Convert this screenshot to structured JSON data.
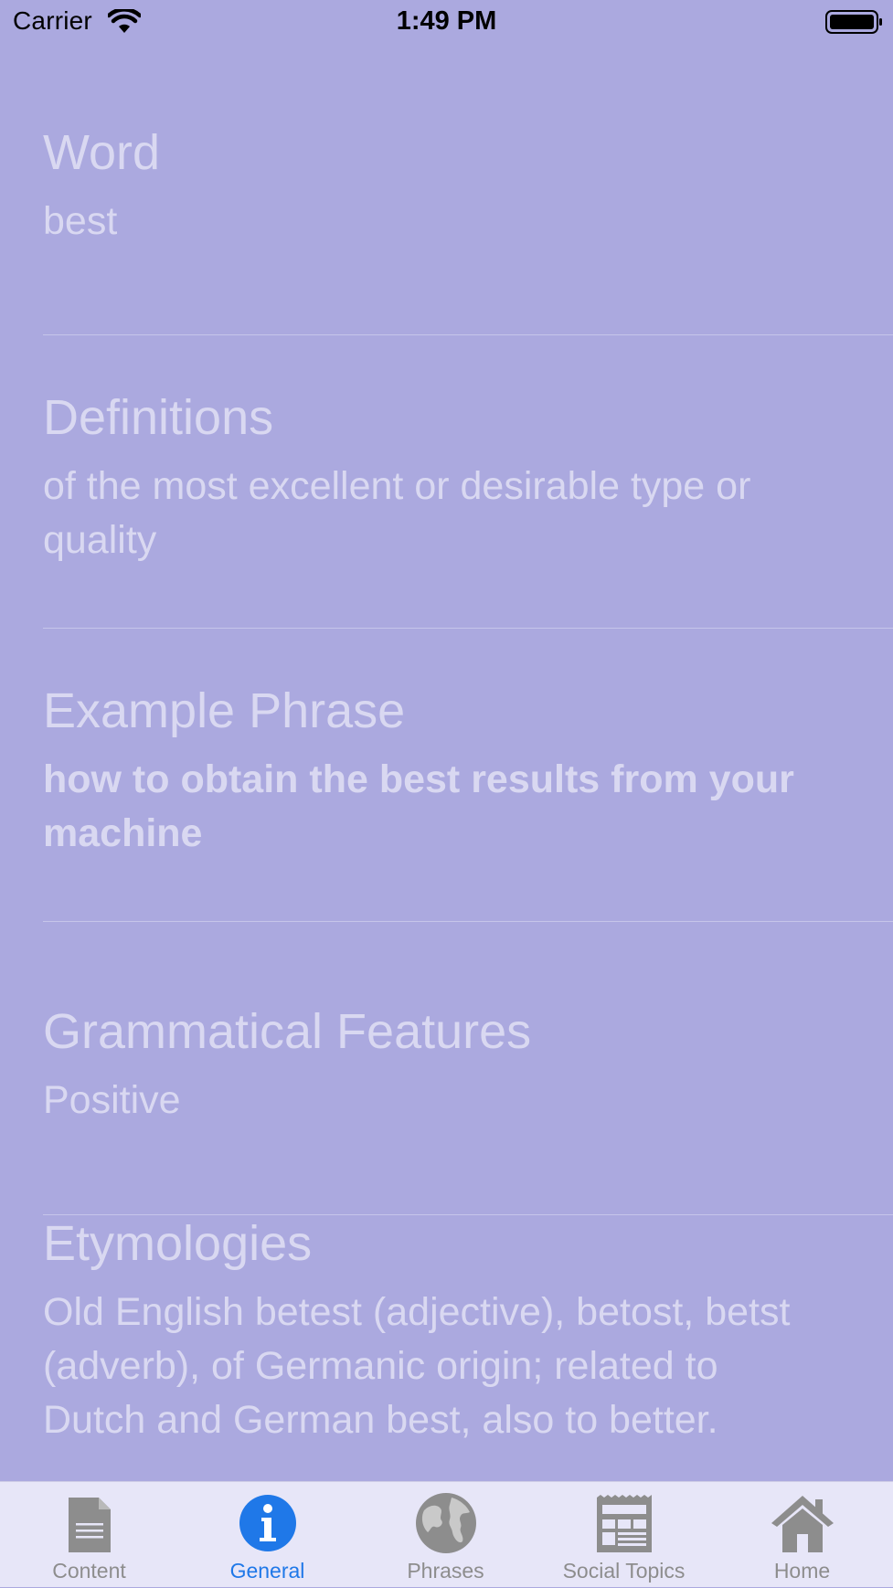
{
  "status_bar": {
    "carrier": "Carrier",
    "time": "1:49 PM"
  },
  "sections": [
    {
      "title": "Word",
      "body": "best"
    },
    {
      "title": "Definitions",
      "body": "of the most excellent or desirable type or quality"
    },
    {
      "title": "Example Phrase",
      "body": "how to obtain the best results from your machine"
    },
    {
      "title": "Grammatical Features",
      "body": "Positive"
    },
    {
      "title": "Etymologies",
      "body": "Old English betest (adjective), betost, betst (adverb), of Germanic origin; related to Dutch and German best, also to better."
    }
  ],
  "tab_bar": {
    "tabs": [
      {
        "label": "Content",
        "icon": "document-icon"
      },
      {
        "label": "General",
        "icon": "info-icon"
      },
      {
        "label": "Phrases",
        "icon": "globe-icon"
      },
      {
        "label": "Social Topics",
        "icon": "newspaper-icon"
      },
      {
        "label": "Home",
        "icon": "home-icon"
      }
    ],
    "active_tab": "General",
    "active_color": "#1f78e8",
    "inactive_color": "#8d8d8d"
  },
  "colors": {
    "background": "#aba9df",
    "text": "#d9d8f1",
    "tab_bar_background": "#e7e6f8"
  }
}
